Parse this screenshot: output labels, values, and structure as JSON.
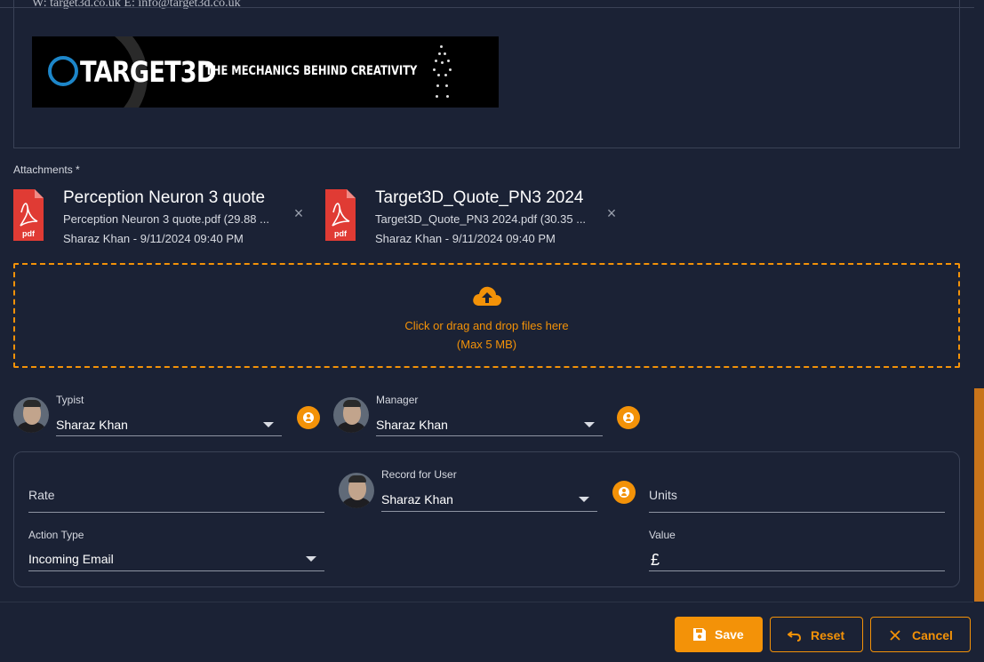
{
  "email_preview": {
    "cut_line": "W: target3d.co.uk  E: info@target3d.co.uk",
    "banner_logo": "TARGET3D",
    "banner_tagline": "THE MECHANICS BEHIND CREATIVITY"
  },
  "attachments": {
    "label": "Attachments *",
    "items": [
      {
        "title": "Perception Neuron 3 quote",
        "file": "Perception Neuron 3 quote.pdf (29.88 ...",
        "meta": "Sharaz Khan - 9/11/2024 09:40 PM",
        "icon_label": "pdf"
      },
      {
        "title": "Target3D_Quote_PN3 2024",
        "file": "Target3D_Quote_PN3 2024.pdf (30.35 ...",
        "meta": "Sharaz Khan - 9/11/2024 09:40 PM",
        "icon_label": "pdf"
      }
    ],
    "close_glyph": "×"
  },
  "dropzone": {
    "line1": "Click or drag and drop files here",
    "line2": "(Max 5 MB)"
  },
  "typist": {
    "label": "Typist",
    "value": "Sharaz Khan"
  },
  "manager": {
    "label": "Manager",
    "value": "Sharaz Khan"
  },
  "record": {
    "rate_placeholder": "Rate",
    "record_for_user": {
      "label": "Record for User",
      "value": "Sharaz Khan"
    },
    "units_placeholder": "Units",
    "action_type": {
      "label": "Action Type",
      "value": "Incoming Email"
    },
    "value_field": {
      "label": "Value",
      "prefix": "£"
    }
  },
  "buttons": {
    "save": "Save",
    "reset": "Reset",
    "cancel": "Cancel"
  },
  "colors": {
    "background": "#1b2235",
    "accent": "#f39208",
    "pdf_red": "#e03b34",
    "border": "#3a4256"
  },
  "icons": [
    "pdf-icon",
    "close-icon",
    "cloud-upload-icon",
    "caret-down-icon",
    "user-circle-icon",
    "save-icon",
    "undo-icon",
    "x-icon"
  ]
}
